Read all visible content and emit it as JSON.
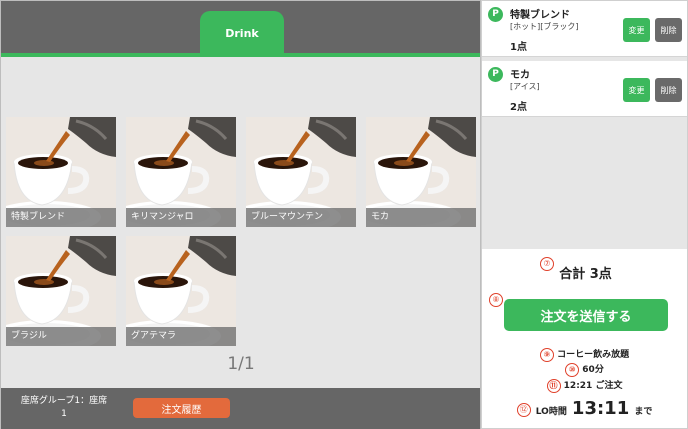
{
  "category_tabs": [
    {
      "label": "Drink"
    }
  ],
  "products": [
    {
      "name": "特製ブレンド"
    },
    {
      "name": "キリマンジャロ"
    },
    {
      "name": "ブルーマウンテン"
    },
    {
      "name": "モカ"
    },
    {
      "name": "ブラジル"
    },
    {
      "name": "グアテマラ"
    }
  ],
  "pager": "1/1",
  "footer": {
    "seat_line1": "座席グループ1：座席",
    "seat_line2": "1",
    "history_button": "注文履歴"
  },
  "cart": {
    "items": [
      {
        "badge": "P",
        "name": "特製ブレンド",
        "options": "[ホット][ブラック]",
        "qty": "1点",
        "change": "変更",
        "delete": "削除"
      },
      {
        "badge": "P",
        "name": "モカ",
        "options": "[アイス]",
        "qty": "2点",
        "change": "変更",
        "delete": "削除"
      }
    ],
    "total": "合計 3点",
    "send_button": "注文を送信する",
    "plan_name": "コーヒー飲み放題",
    "plan_duration": "60分",
    "ordered_at": "12:21 ご注文",
    "lo_label": "LO時間",
    "lo_time": "13:11",
    "lo_suffix": "まで"
  },
  "annotations": {
    "a7": "⑦",
    "a8": "⑧",
    "a9": "⑨",
    "a10": "⑩",
    "a11": "⑪",
    "a12": "⑫"
  },
  "colors": {
    "accent": "#3cb85c",
    "history": "#e36a3c",
    "bar": "#666666",
    "annotation": "#e0402a"
  }
}
